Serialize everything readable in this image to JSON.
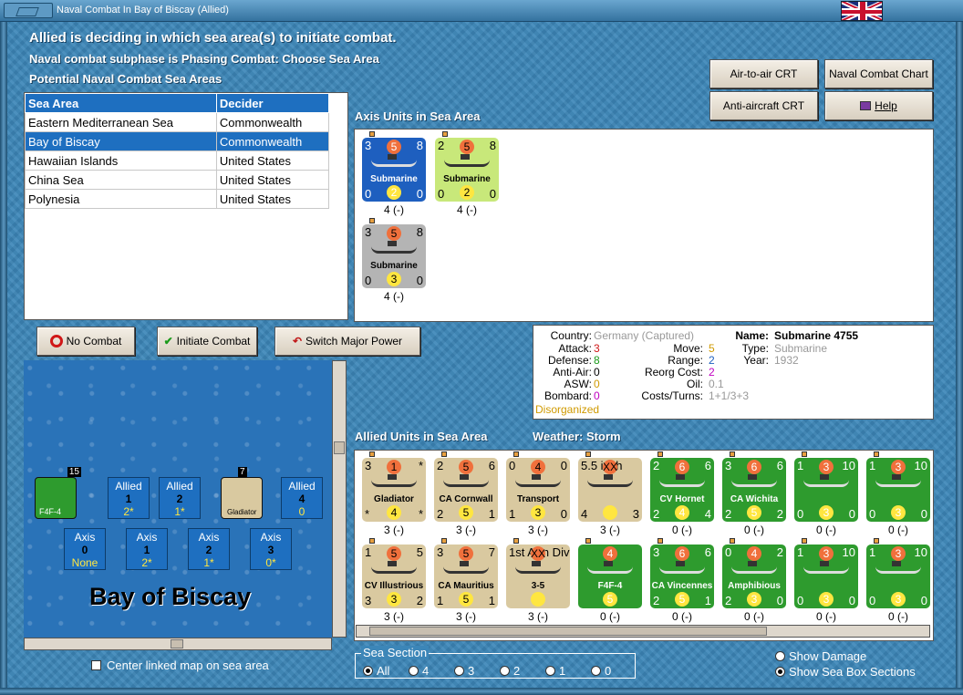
{
  "window": {
    "title": "Naval Combat In Bay of Biscay (Allied)"
  },
  "header": {
    "line1": "Allied is deciding in which sea area(s) to initiate combat.",
    "line2": "Naval combat subphase is Phasing Combat: Choose Sea Area",
    "line3": "Potential Naval Combat Sea Areas"
  },
  "buttons": {
    "air_to_air": "Air-to-air CRT",
    "naval_chart": "Naval Combat Chart",
    "anti_aircraft": "Anti-aircraft CRT",
    "help": "Help",
    "no_combat": "No Combat",
    "initiate_combat": "Initiate Combat",
    "switch_power": "Switch Major Power"
  },
  "sea_table": {
    "headers": [
      "Sea Area",
      "Decider"
    ],
    "rows": [
      [
        "Eastern Mediterranean Sea",
        "Commonwealth"
      ],
      [
        "Bay of Biscay",
        "Commonwealth"
      ],
      [
        "Hawaiian Islands",
        "United States"
      ],
      [
        "China Sea",
        "United States"
      ],
      [
        "Polynesia",
        "United States"
      ]
    ],
    "selected": 1
  },
  "axis": {
    "label": "Axis Units in Sea Area",
    "units": [
      {
        "tl": "3",
        "tc": "5",
        "tr": "8",
        "name": "Submarine",
        "bl": "0",
        "bc": "2",
        "br": "0",
        "cap": "4 (-)",
        "color": "#1e5fbf"
      },
      {
        "tl": "2",
        "tc": "5",
        "tr": "8",
        "name": "Submarine",
        "bl": "0",
        "bc": "2",
        "br": "0",
        "cap": "4 (-)",
        "color": "#c8e87a"
      },
      {
        "tl": "3",
        "tc": "5",
        "tr": "8",
        "name": "Submarine",
        "bl": "0",
        "bc": "3",
        "br": "0",
        "cap": "4 (-)",
        "color": "#b4b4b4"
      }
    ]
  },
  "info": {
    "country_label": "Country:",
    "country": "Germany (Captured)",
    "attack_label": "Attack:",
    "attack": "3",
    "defense_label": "Defense:",
    "defense": "8",
    "antiair_label": "Anti-Air:",
    "antiair": "0",
    "asw_label": "ASW:",
    "asw": "0",
    "bombard_label": "Bombard:",
    "bombard": "0",
    "status": "Disorganized",
    "move_label": "Move:",
    "move": "5",
    "range_label": "Range:",
    "range": "2",
    "reorg_label": "Reorg Cost:",
    "reorg": "2",
    "oil_label": "Oil:",
    "oil": "0.1",
    "costs_label": "Costs/Turns:",
    "costs": "1+1/3+3",
    "name_label": "Name:",
    "name": "Submarine 4755",
    "type_label": "Type:",
    "type": "Submarine",
    "year_label": "Year:",
    "year": "1932"
  },
  "allied": {
    "label": "Allied Units in Sea Area",
    "weather_label": "Weather:",
    "weather": "Storm",
    "units": [
      {
        "tl": "3",
        "tc": "1",
        "tr": "*",
        "name": "Gladiator",
        "bl": "*",
        "bc": "4",
        "br": "*",
        "cap": "3 (-)",
        "color": "#d9c9a0"
      },
      {
        "tl": "2",
        "tc": "5",
        "tr": "6",
        "name": "CA Cornwall",
        "bl": "2",
        "bc": "5",
        "br": "1",
        "cap": "3 (-)",
        "color": "#d9c9a0"
      },
      {
        "tl": "0",
        "tc": "4",
        "tr": "0",
        "name": "Transport",
        "bl": "1",
        "bc": "3",
        "br": "0",
        "cap": "3 (-)",
        "color": "#d9c9a0"
      },
      {
        "tl": "5.5 inch",
        "tc": "XX",
        "tr": "",
        "name": "",
        "bl": "4",
        "bc": "",
        "br": "3",
        "cap": "3 (-)",
        "color": "#d9c9a0"
      },
      {
        "tl": "2",
        "tc": "6",
        "tr": "6",
        "name": "CV Hornet",
        "bl": "2",
        "bc": "4",
        "br": "4",
        "cap": "0 (-)",
        "color": "#2e9b2e"
      },
      {
        "tl": "3",
        "tc": "6",
        "tr": "6",
        "name": "CA Wichita",
        "bl": "2",
        "bc": "5",
        "br": "2",
        "cap": "0 (-)",
        "color": "#2e9b2e"
      },
      {
        "tl": "1",
        "tc": "3",
        "tr": "10",
        "name": "",
        "bl": "0",
        "bc": "3",
        "br": "0",
        "cap": "0 (-)",
        "color": "#2e9b2e"
      },
      {
        "tl": "1",
        "tc": "3",
        "tr": "10",
        "name": "",
        "bl": "0",
        "bc": "3",
        "br": "0",
        "cap": "0 (-)",
        "color": "#2e9b2e"
      },
      {
        "tl": "1",
        "tc": "5",
        "tr": "5",
        "name": "CV Illustrious",
        "bl": "3",
        "bc": "3",
        "br": "2",
        "cap": "3 (-)",
        "color": "#d9c9a0"
      },
      {
        "tl": "3",
        "tc": "5",
        "tr": "7",
        "name": "CA Mauritius",
        "bl": "1",
        "bc": "5",
        "br": "1",
        "cap": "3 (-)",
        "color": "#d9c9a0"
      },
      {
        "tl": "1st Arm Div",
        "tc": "XX",
        "tr": "",
        "name": "3-5",
        "bl": "",
        "bc": "",
        "br": "",
        "cap": "3 (-)",
        "color": "#d9c9a0"
      },
      {
        "tl": "",
        "tc": "4",
        "tr": "",
        "name": "F4F-4",
        "bl": "",
        "bc": "5",
        "br": "",
        "cap": "0 (-)",
        "color": "#2e9b2e"
      },
      {
        "tl": "3",
        "tc": "6",
        "tr": "6",
        "name": "CA Vincennes",
        "bl": "2",
        "bc": "5",
        "br": "1",
        "cap": "0 (-)",
        "color": "#2e9b2e"
      },
      {
        "tl": "0",
        "tc": "4",
        "tr": "2",
        "name": "Amphibious",
        "bl": "2",
        "bc": "3",
        "br": "0",
        "cap": "0 (-)",
        "color": "#2e9b2e"
      },
      {
        "tl": "1",
        "tc": "3",
        "tr": "10",
        "name": "",
        "bl": "0",
        "bc": "3",
        "br": "0",
        "cap": "0 (-)",
        "color": "#2e9b2e"
      },
      {
        "tl": "1",
        "tc": "3",
        "tr": "10",
        "name": "",
        "bl": "0",
        "bc": "3",
        "br": "0",
        "cap": "0 (-)",
        "color": "#2e9b2e"
      }
    ]
  },
  "map": {
    "name": "Bay of Biscay",
    "allied_boxes": [
      {
        "a": "Allied",
        "b": "1",
        "c": "2*"
      },
      {
        "a": "Allied",
        "b": "2",
        "c": "1*"
      },
      {
        "a": "Allied",
        "b": "4",
        "c": "0"
      }
    ],
    "axis_boxes": [
      {
        "a": "Axis",
        "b": "0",
        "c": "None"
      },
      {
        "a": "Axis",
        "b": "1",
        "c": "2*"
      },
      {
        "a": "Axis",
        "b": "2",
        "c": "1*"
      },
      {
        "a": "Axis",
        "b": "3",
        "c": "0*"
      }
    ],
    "f4f_stack": "15",
    "f4f_label": "F4F-4",
    "glad_stack": "7",
    "glad_label": "Gladiator"
  },
  "sea_section": {
    "label": "Sea Section",
    "options": [
      "All",
      "4",
      "3",
      "2",
      "1",
      "0"
    ],
    "selected": 0
  },
  "options": {
    "center_map": "Center linked map on sea area",
    "show_damage": "Show Damage",
    "show_sections": "Show Sea Box Sections"
  }
}
